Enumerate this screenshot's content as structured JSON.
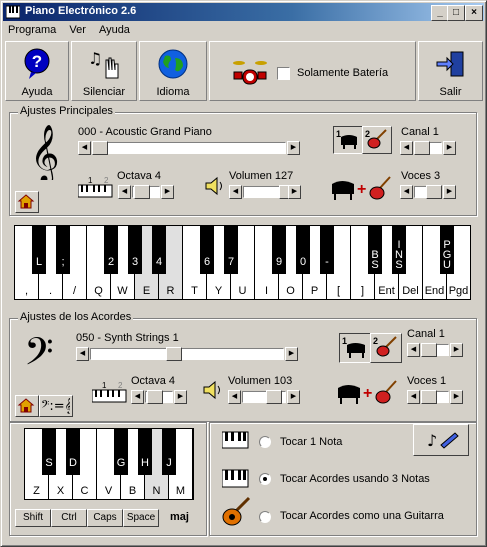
{
  "window": {
    "title": "Piano Electrónico 2.6"
  },
  "menu": [
    "Programa",
    "Ver",
    "Ayuda"
  ],
  "toolbar": {
    "ayuda": "Ayuda",
    "silenciar": "Silenciar",
    "idioma": "Idioma",
    "solo_bateria": "Solamente Batería",
    "salir": "Salir"
  },
  "principales": {
    "title": "Ajustes Principales",
    "instrument": "000 - Acoustic Grand Piano",
    "canal": "Canal 1",
    "octava": "Octava 4",
    "volumen": "Volumen 127",
    "voces": "Voces 3",
    "num1": "1",
    "num2": "2"
  },
  "main_keyboard": {
    "white_labels": [
      ".",
      "/",
      "Q",
      "W",
      "E",
      "R",
      "T",
      "Y",
      "U",
      "I",
      "O",
      "P",
      "[",
      "]",
      "Ent",
      "Del",
      "End",
      "Pgd"
    ],
    "black_labels": [
      "L",
      ";",
      "2",
      "3",
      "4",
      "6",
      "7",
      "9",
      "0",
      "-",
      "BS",
      "INS",
      "PGU"
    ]
  },
  "acordes": {
    "title": "Ajustes de los Acordes",
    "instrument": "050 - Synth Strings 1",
    "canal": "Canal 1",
    "octava": "Octava 4",
    "volumen": "Volumen 103",
    "voces": "Voces 1"
  },
  "chord_keyboard": {
    "white_labels": [
      "Z",
      "X",
      "C",
      "V",
      "B",
      "N",
      "M"
    ],
    "black_labels": [
      "S",
      "D",
      "G",
      "H",
      "J"
    ],
    "modifiers": [
      "Shift",
      "Ctrl",
      "Caps",
      "Space"
    ],
    "maj": "maj"
  },
  "modes": {
    "one_note": "Tocar 1 Nota",
    "three_notes": "Tocar Acordes usando 3 Notas",
    "guitar": "Tocar Acordes como una Guitarra",
    "selected": "three_notes"
  }
}
